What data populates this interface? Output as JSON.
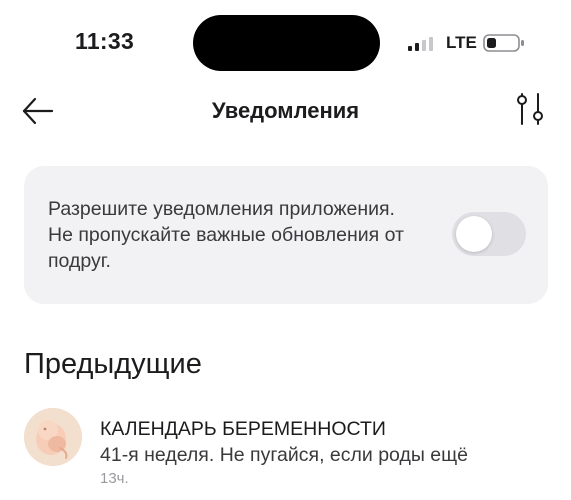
{
  "status_bar": {
    "time": "11:33",
    "network": "LTE",
    "signal_icon": "signal-bars-icon",
    "battery_icon": "battery-low-icon"
  },
  "nav": {
    "back_icon": "arrow-left-icon",
    "title": "Уведомления",
    "filter_icon": "sliders-icon"
  },
  "permission_card": {
    "text": "Разрешите уведомления приложения. Не пропускайте важные обновления от подруг.",
    "toggle_on": false
  },
  "section": {
    "title": "Предыдущие"
  },
  "notifications": [
    {
      "avatar": "fetus-illustration",
      "title": "КАЛЕНДАРЬ БЕРЕМЕННОСТИ",
      "body": "41-я неделя. Не пугайся, если роды ещё",
      "time": "13ч."
    }
  ],
  "colors": {
    "card_background": "#f2f2f5",
    "toggle_off": "#dfdfe4",
    "muted_text": "#9a9aa0"
  }
}
